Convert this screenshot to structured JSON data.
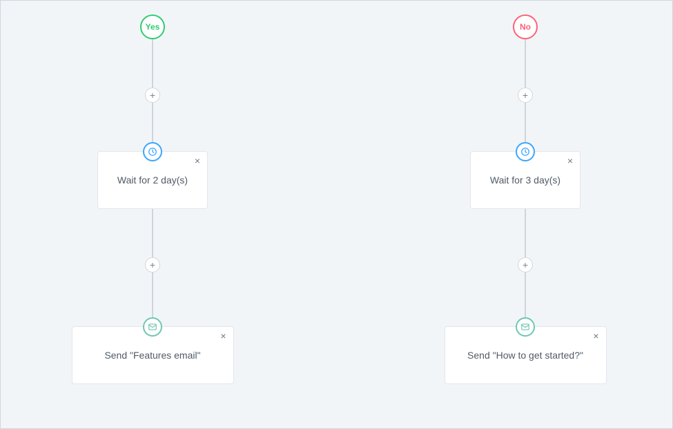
{
  "flow": {
    "branches": [
      {
        "id": "yes",
        "outcome_label": "Yes",
        "outcome_color": "#2ecc71",
        "steps": [
          {
            "type": "wait",
            "icon": "clock",
            "label": "Wait for 2 day(s)"
          },
          {
            "type": "email",
            "icon": "mail",
            "label": "Send \"Features email\""
          }
        ]
      },
      {
        "id": "no",
        "outcome_label": "No",
        "outcome_color": "#ff6078",
        "steps": [
          {
            "type": "wait",
            "icon": "clock",
            "label": "Wait for 3 day(s)"
          },
          {
            "type": "email",
            "icon": "mail",
            "label": "Send \"How to get started?\""
          }
        ]
      }
    ],
    "add_button_glyph": "+",
    "close_glyph": "×"
  }
}
